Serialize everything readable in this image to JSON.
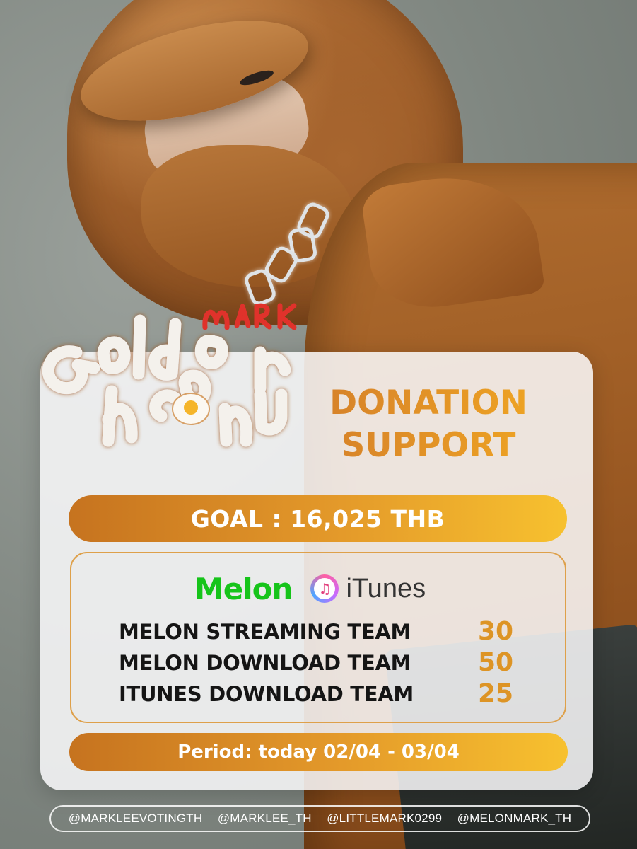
{
  "logo": {
    "artist": "MARK",
    "album": "Golden Hour"
  },
  "title": {
    "line1": "DONATION",
    "line2": "SUPPORT"
  },
  "goal": "GOAL : 16,025 THB",
  "platforms": {
    "melon": "Melon",
    "itunes": "iTunes",
    "itunes_icon": "music-note-icon"
  },
  "teams": [
    {
      "label": "MELON STREAMING TEAM",
      "count": "30"
    },
    {
      "label": "MELON DOWNLOAD TEAM",
      "count": "50"
    },
    {
      "label": "ITUNES DOWNLOAD TEAM",
      "count": "25"
    }
  ],
  "period": "Period: today 02/04 - 03/04",
  "handles": [
    "@MARKLEEVOTINGTH",
    "@MARKLEE_TH",
    "@LITTLEMARK0299",
    "@MELONMARK_TH"
  ],
  "colors": {
    "accent_start": "#c6731f",
    "accent_end": "#f7c12f",
    "melon_green": "#16c41a",
    "count_orange": "#dd9425"
  }
}
